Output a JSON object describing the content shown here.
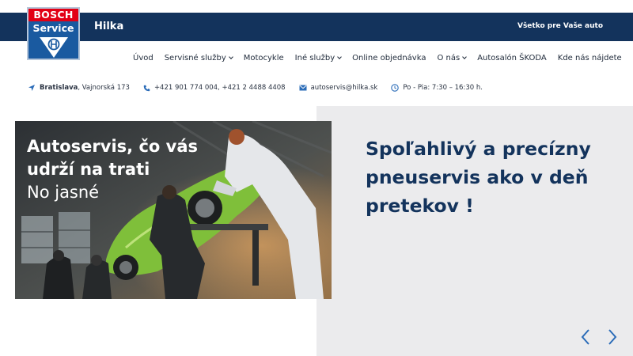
{
  "header": {
    "logo_brand": "BOSCH",
    "logo_service": "Service",
    "brand_name": "Hilka",
    "tagline": "Všetko pre Vaše auto"
  },
  "nav": {
    "items": [
      {
        "label": "Úvod",
        "dropdown": false
      },
      {
        "label": "Servisné služby",
        "dropdown": true
      },
      {
        "label": "Motocykle",
        "dropdown": false
      },
      {
        "label": "Iné služby",
        "dropdown": true
      },
      {
        "label": "Online objednávka",
        "dropdown": false
      },
      {
        "label": "O nás",
        "dropdown": true
      },
      {
        "label": "Autosalón ŠKODA",
        "dropdown": false
      },
      {
        "label": "Kde nás nájdete",
        "dropdown": false
      }
    ]
  },
  "contact": {
    "city": "Bratislava",
    "street": ", Vajnorská 173",
    "phones": "+421 901 774 004, +421 2 4488 4408",
    "email": "autoservis@hilka.sk",
    "hours": "Po - Pia: 7:30 – 16:30 h."
  },
  "hero": {
    "image_line1": "Autoservis, čo vás",
    "image_line2": "udrží na trati",
    "image_line3": "No jasné",
    "slide_title": "Spoľahlivý a precízny pneuservis ako v deň pretekov !"
  },
  "icons": {
    "location": "map-pointer-icon",
    "phone": "phone-icon",
    "email": "envelope-icon",
    "hours": "clock-icon",
    "prev": "chevron-left-icon",
    "next": "chevron-right-icon"
  },
  "colors": {
    "navy": "#13335c",
    "bosch_red": "#e20015",
    "bosch_blue": "#1a5aa0",
    "accent_blue": "#2b6cb8",
    "hero_bg": "#ebebed"
  }
}
